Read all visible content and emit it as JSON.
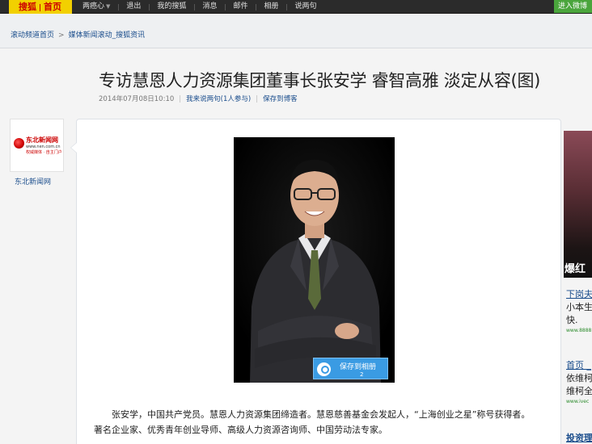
{
  "topbar": {
    "logo_left": "搜狐",
    "logo_right": "首页",
    "nav": [
      "两癌心",
      "退出",
      "我的搜狐",
      "消息",
      "邮件",
      "相册",
      "说两句"
    ],
    "enter_button": "进入微博"
  },
  "breadcrumb": {
    "home": "滚动频道首页",
    "current": "媒体新闻滚动_搜狐资讯",
    "separator": ">"
  },
  "article": {
    "title": "专访慧恩人力资源集团董事长张安学 睿智高雅 淡定从容(图)",
    "datetime": "2014年07月08日10:10",
    "comment_link": "我来说两句",
    "comment_count": "(1人参与)",
    "save_blog": "保存到博客",
    "save_album_label": "保存到相册",
    "save_album_count": "2",
    "paragraphs": [
      "张安学，中国共产党员。慧恩人力资源集团缔造者。慧恩慈善基金会发起人，“上海创业之星”称号获得者。著名企业家、优秀青年创业导师、高级人力资源咨询师、中国劳动法专家。"
    ]
  },
  "source": {
    "logo_name": "东北新闻网",
    "logo_url": "www.nen.com.cn",
    "logo_tagline": "权威媒体 · 自主门户",
    "name": "东北新闻网"
  },
  "sidebar": {
    "ad_caption": "爆红",
    "items": [
      {
        "link": "下岗夫",
        "text1": "小本生",
        "text2": "快.",
        "url": "www.8888"
      },
      {
        "link": "首页 _",
        "text1": "依维柯",
        "text2": "维柯全",
        "url": "www.ivec"
      },
      {
        "link": "投资理"
      }
    ]
  },
  "colors": {
    "topbar": "#2b2b2b",
    "logo_bg": "#f2d000",
    "link": "#1a4d8c",
    "enter_button": "#4aa53c",
    "save_album": "#3a9be3"
  }
}
